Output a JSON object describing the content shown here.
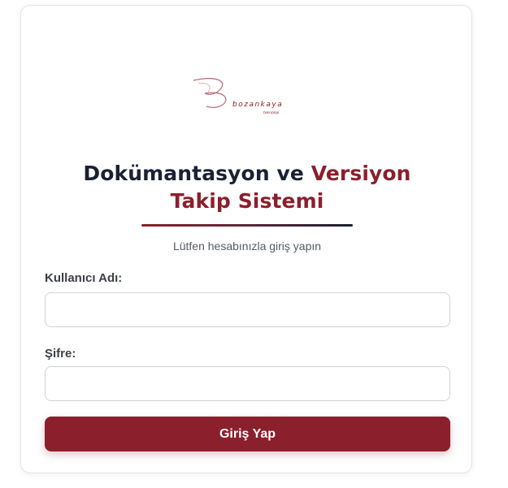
{
  "logo": {
    "brand_text": "bozankaya",
    "tagline": "teknoloji"
  },
  "header": {
    "title_part1": "Dokümantasyon ve ",
    "title_accent_1": "Versiyon",
    "title_accent_2": "Takip Sistemi",
    "subtitle": "Lütfen hesabınızla giriş yapın"
  },
  "form": {
    "username_label": "Kullanıcı Adı:",
    "username_value": "",
    "password_label": "Şifre:",
    "password_value": "",
    "submit_label": "Giriş Yap"
  },
  "colors": {
    "accent": "#8c1f2c",
    "title_dark": "#1a2133"
  }
}
